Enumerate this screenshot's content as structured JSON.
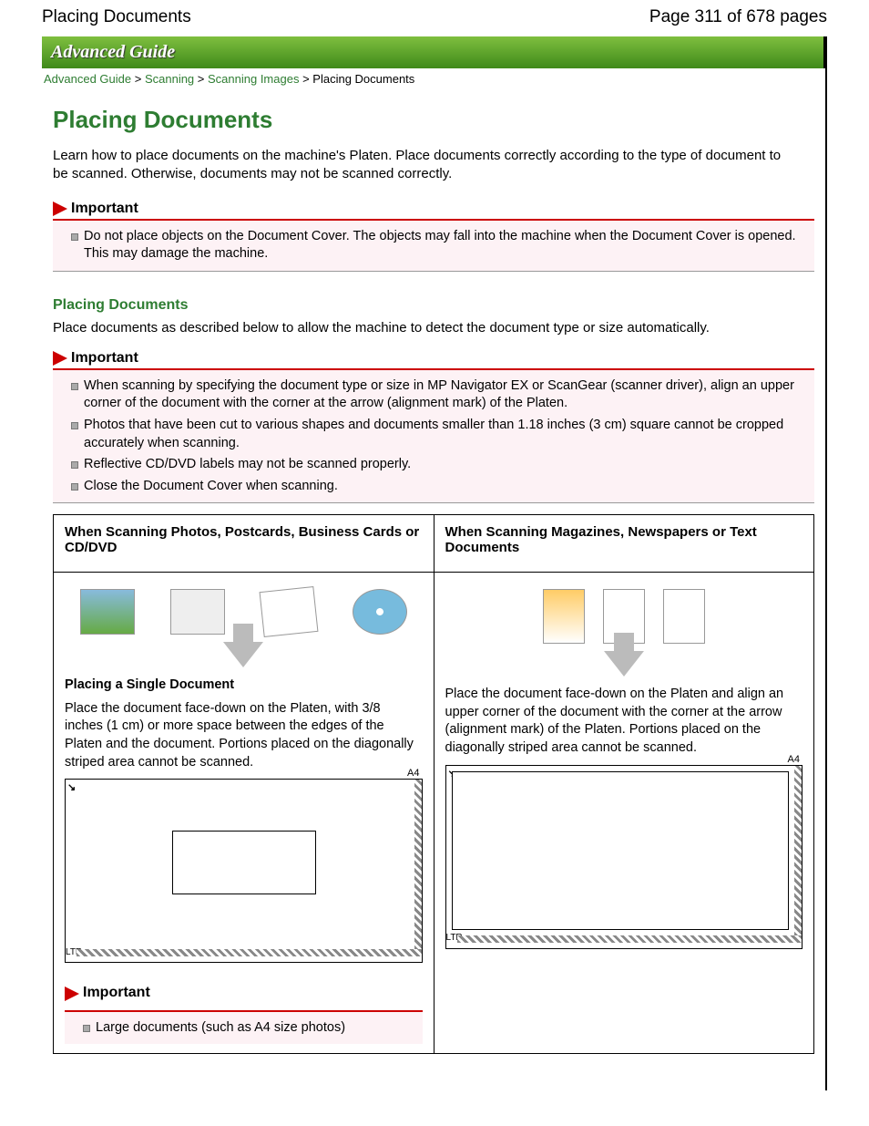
{
  "header": {
    "title": "Placing Documents",
    "pageinfo": "Page 311 of 678 pages",
    "band": "Advanced Guide"
  },
  "crumbs": {
    "a": "Advanced Guide",
    "b": "Scanning",
    "c": "Scanning Images",
    "d": "Placing Documents"
  },
  "main": {
    "title": "Placing Documents",
    "intro": "Learn how to place documents on the machine's Platen. Place documents correctly according to the type of document to be scanned. Otherwise, documents may not be scanned correctly.",
    "imp1_label": "Important",
    "imp1_items": [
      "Do not place objects on the Document Cover. The objects may fall into the machine when the Document Cover is opened. This may damage the machine."
    ],
    "subhead": "Placing Documents",
    "subtext": "Place documents as described below to allow the machine to detect the document type or size automatically.",
    "imp2_label": "Important",
    "imp2_items": [
      "When scanning by specifying the document type or size in MP Navigator EX or ScanGear (scanner driver), align an upper corner of the document with the corner at the arrow (alignment mark) of the Platen.",
      "Photos that have been cut to various shapes and documents smaller than 1.18 inches (3 cm) square cannot be cropped accurately when scanning.",
      "Reflective CD/DVD labels may not be scanned properly.",
      "Close the Document Cover when scanning."
    ],
    "colL": {
      "head": "When Scanning Photos, Postcards, Business Cards or CD/DVD",
      "sub": "Placing a Single Document",
      "text": "Place the document face-down on the Platen, with 3/8 inches (1 cm) or more space between the edges of the Platen and the document. Portions placed on the diagonally striped area cannot be scanned.",
      "imp_label": "Important",
      "imp_items": [
        "Large documents (such as A4 size photos)"
      ]
    },
    "colR": {
      "head": "When Scanning Magazines, Newspapers or Text Documents",
      "text": "Place the document face-down on the Platen and align an upper corner of the document with the corner at the arrow (alignment mark) of the Platen. Portions placed on the diagonally striped area cannot be scanned."
    },
    "labels": {
      "a4": "A4",
      "ltr": "LTR",
      "corner": "↘"
    }
  }
}
